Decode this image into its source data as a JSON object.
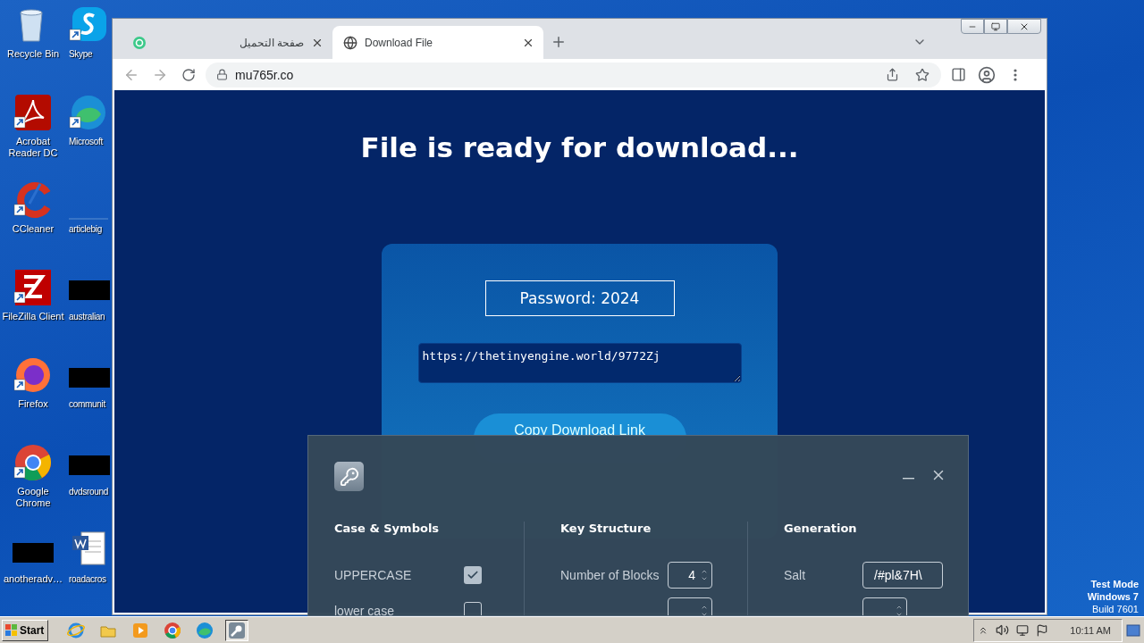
{
  "desktop": {
    "columns": [
      {
        "icons": [
          {
            "label": "Recycle Bin",
            "kind": "recycle",
            "shortcut": false
          },
          {
            "label": "Acrobat Reader DC",
            "kind": "acrobat",
            "shortcut": true
          },
          {
            "label": "CCleaner",
            "kind": "ccleaner",
            "shortcut": true
          },
          {
            "label": "FileZilla Client",
            "kind": "filezilla",
            "shortcut": true
          },
          {
            "label": "Firefox",
            "kind": "firefox",
            "shortcut": true
          },
          {
            "label": "Google Chrome",
            "kind": "chrome",
            "shortcut": true
          },
          {
            "label": "anotheradv…",
            "kind": "redacted",
            "shortcut": false
          }
        ]
      },
      {
        "icons": [
          {
            "label": "Skype",
            "kind": "skype",
            "shortcut": true
          },
          {
            "label": "Microsoft",
            "kind": "edge",
            "shortcut": true
          },
          {
            "label": "articlebig",
            "kind": "blank",
            "shortcut": false
          },
          {
            "label": "australian",
            "kind": "redacted",
            "shortcut": false
          },
          {
            "label": "communit",
            "kind": "redacted",
            "shortcut": false
          },
          {
            "label": "dvdsround",
            "kind": "redacted",
            "shortcut": false
          },
          {
            "label": "roadacros",
            "kind": "word",
            "shortcut": false
          }
        ]
      }
    ],
    "notice": [
      "Test Mode",
      "Windows 7",
      "Build 7601"
    ]
  },
  "browser": {
    "tabs": [
      {
        "title": "صفحة التحميل",
        "kind": "green",
        "selected": false
      },
      {
        "title": "Download File",
        "kind": "globe",
        "selected": true
      }
    ],
    "address": "mu765r.co",
    "page": {
      "heading": "File is ready for download...",
      "password": "Password: 2024",
      "link": "https://thetinyengine.world/9772Zj",
      "button": "Copy Download Link"
    }
  },
  "dialog": {
    "columns": [
      {
        "title": "Case & Symbols",
        "rows": [
          {
            "kind": "checkbox",
            "label": "UPPERCASE",
            "checked": true
          },
          {
            "kind": "checkbox",
            "label": "lower case",
            "checked": false
          }
        ]
      },
      {
        "title": "Key Structure",
        "rows": [
          {
            "kind": "spin",
            "label": "Number of Blocks",
            "value": "4"
          },
          {
            "kind": "spin"
          }
        ]
      },
      {
        "title": "Generation",
        "rows": [
          {
            "kind": "text",
            "label": "Salt",
            "value": "/#pl&7H\\"
          },
          {
            "kind": "spin"
          }
        ]
      }
    ]
  },
  "taskbar": {
    "start": "Start",
    "apps": [
      {
        "kind": "ie",
        "selected": false
      },
      {
        "kind": "explorer",
        "selected": false
      },
      {
        "kind": "media",
        "selected": false
      },
      {
        "kind": "chrome",
        "selected": false
      },
      {
        "kind": "edge",
        "selected": false
      },
      {
        "kind": "key",
        "selected": true
      }
    ],
    "time": "10:11 AM"
  }
}
